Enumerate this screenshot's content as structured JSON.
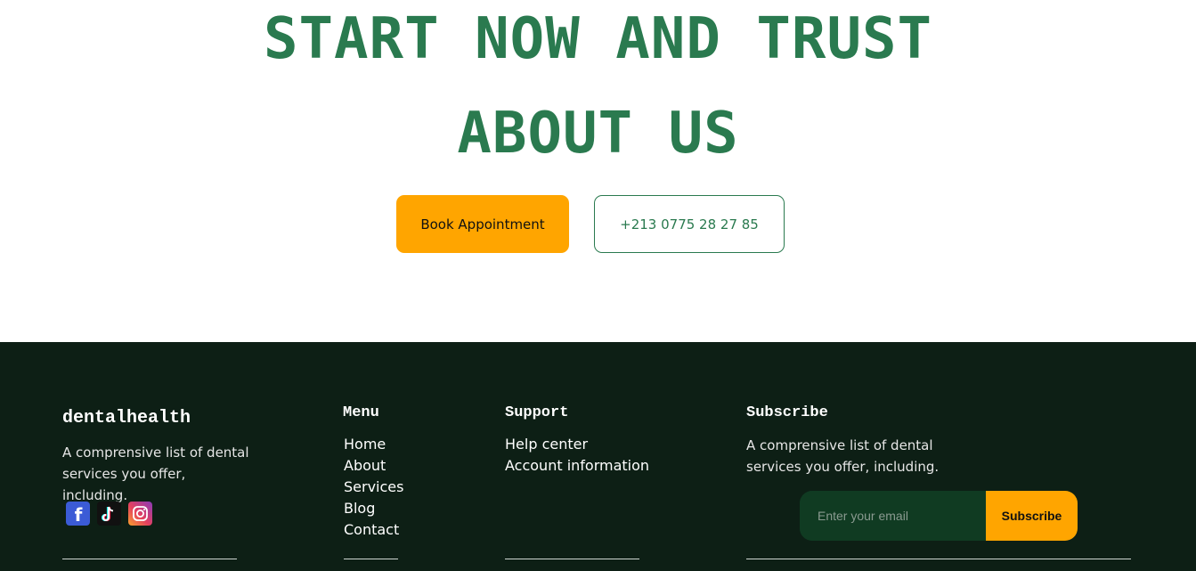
{
  "hero": {
    "headline_line1": "START NOW AND TRUST",
    "headline_line2": "ABOUT US",
    "book_button": "Book Appointment",
    "phone_button": "+213 0775 28 27 85"
  },
  "footer": {
    "brand": "dentalhealth",
    "brand_description": "A comprensive list of dental services you offer, including.",
    "socials": [
      {
        "name": "facebook",
        "glyph": "f"
      },
      {
        "name": "tiktok",
        "glyph": "♪"
      },
      {
        "name": "instagram",
        "glyph": "◎"
      }
    ],
    "menu": {
      "title": "Menu",
      "items": [
        "Home",
        "About",
        "Services",
        "Blog",
        "Contact"
      ]
    },
    "support": {
      "title": "Support",
      "items": [
        "Help center",
        "Account information"
      ]
    },
    "subscribe": {
      "title": "Subscribe",
      "description": "A comprensive list of dental services you offer, including.",
      "input_placeholder": "Enter your email",
      "button": "Subscribe"
    }
  },
  "colors": {
    "accent_green": "#2a7a4f",
    "cta_orange": "#ffa500",
    "footer_bg": "#0d1f15"
  }
}
